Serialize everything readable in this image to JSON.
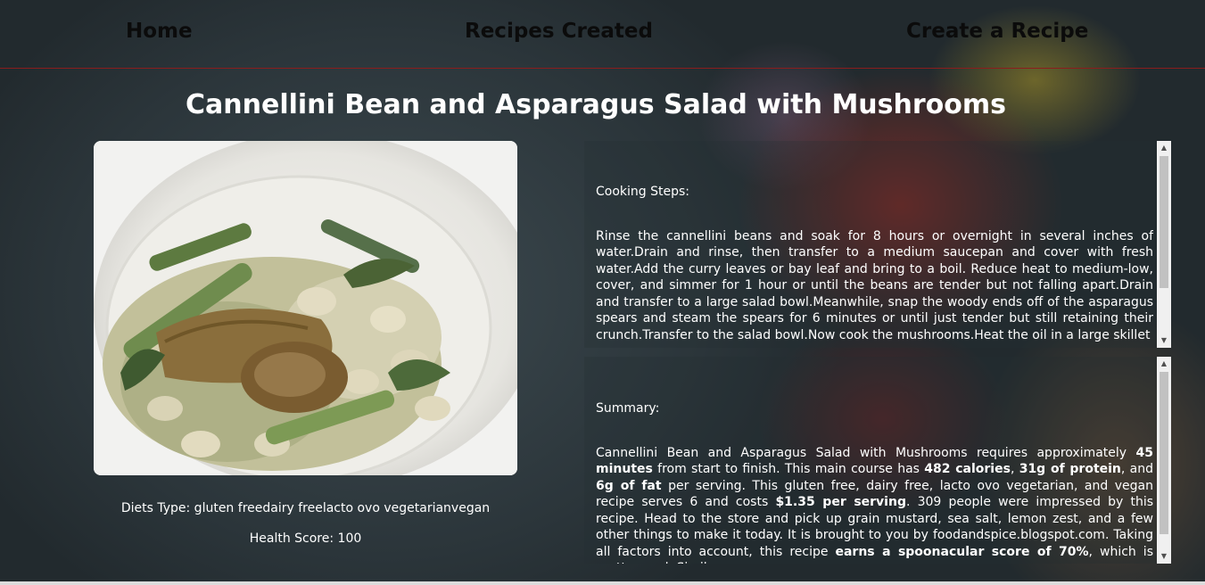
{
  "nav": {
    "home": "Home",
    "recipes_created": "Recipes Created",
    "create_recipe": "Create a Recipe"
  },
  "recipe": {
    "title": "Cannellini Bean and Asparagus Salad with Mushrooms",
    "diets": "Diets Type: gluten freedairy freelacto ovo vegetarianvegan",
    "health_score": "Health Score: 100",
    "cooking_label": "Cooking Steps:",
    "steps_text": "Rinse the cannellini beans and soak for 8 hours or overnight in several inches of water.Drain and rinse, then transfer to a medium saucepan and cover with fresh water.Add the curry leaves or bay leaf and bring to a boil. Reduce heat to medium-low, cover, and simmer for 1 hour or until the beans are tender but not falling apart.Drain and transfer to a large salad bowl.Meanwhile, snap the woody ends off of the asparagus spears and steam the spears for 6 minutes or until just tender but still retaining their crunch.Transfer to the salad bowl.Now cook the mushrooms.Heat the oil in a large skillet",
    "summary_label": "Summary:",
    "summary": {
      "s1": "Cannellini Bean and Asparagus Salad with Mushrooms requires approximately ",
      "b1": "45 minutes",
      "s2": " from start to finish. This main course has ",
      "b2": "482 calories",
      "s3": ", ",
      "b3": "31g of protein",
      "s4": ", and ",
      "b4": "6g of fat",
      "s5": " per serving. This gluten free, dairy free, lacto ovo vegetarian, and vegan recipe serves 6 and costs ",
      "b5": "$1.35 per serving",
      "s6": ". 309 people were impressed by this recipe. Head to the store and pick up grain mustard, sea salt, lemon zest, and a few other things to make it today. It is brought to you by foodandspice.blogspot.com. Taking all factors into account, this recipe ",
      "b6": "earns a spoonacular score of 70%",
      "s7": ", which is pretty good. Similar"
    }
  },
  "icons": {
    "scroll_up": "arrow-up-icon",
    "scroll_down": "arrow-down-icon"
  }
}
